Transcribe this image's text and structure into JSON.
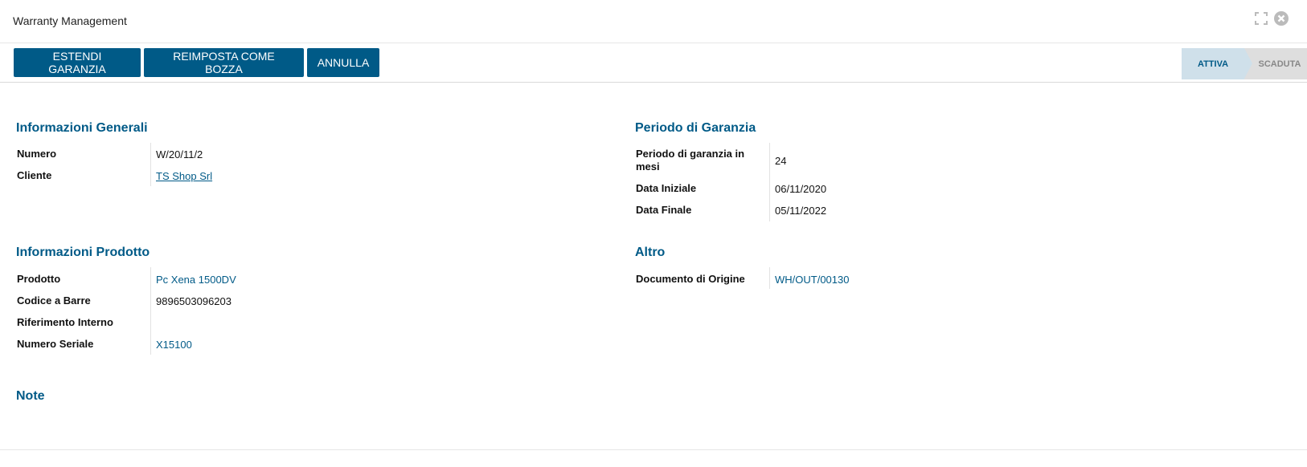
{
  "window": {
    "title": "Warranty Management"
  },
  "toolbar": {
    "extend_label": "ESTENDI GARANZIA",
    "reset_label": "REIMPOSTA COME BOZZA",
    "cancel_label": "ANNULLA"
  },
  "status": {
    "stages": [
      "ATTIVA",
      "SCADUTA"
    ],
    "active": "ATTIVA"
  },
  "general": {
    "title": "Informazioni Generali",
    "numero_label": "Numero",
    "numero_value": "W/20/11/2",
    "cliente_label": "Cliente",
    "cliente_value": "TS Shop Srl"
  },
  "period": {
    "title": "Periodo di Garanzia",
    "months_label": "Periodo di garanzia in mesi",
    "months_value": "24",
    "start_label": "Data Iniziale",
    "start_value": "06/11/2020",
    "end_label": "Data Finale",
    "end_value": "05/11/2022"
  },
  "product": {
    "title": "Informazioni Prodotto",
    "prodotto_label": "Prodotto",
    "prodotto_value": "Pc Xena 1500DV",
    "barcode_label": "Codice a Barre",
    "barcode_value": "9896503096203",
    "internal_ref_label": "Riferimento Interno",
    "internal_ref_value": "",
    "serial_label": "Numero Seriale",
    "serial_value": "X15100"
  },
  "other": {
    "title": "Altro",
    "origin_label": "Documento di Origine",
    "origin_value": "WH/OUT/00130"
  },
  "notes": {
    "title": "Note"
  },
  "icons": {
    "expand": "expand-icon",
    "close": "close-icon"
  },
  "colors": {
    "primary": "#005a87",
    "stage_active_bg": "#cfe0ea",
    "stage_inactive_bg": "#dedede"
  }
}
